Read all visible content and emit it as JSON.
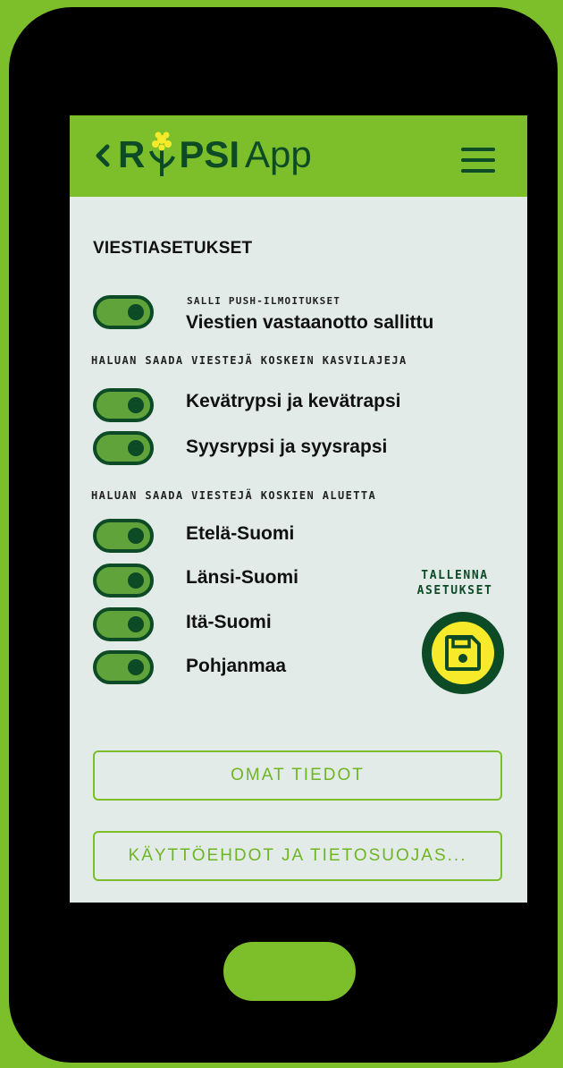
{
  "app": {
    "logo_r": "R",
    "logo_psi": "PSI",
    "logo_app": "App"
  },
  "settings": {
    "title": "VIESTIASETUKSET",
    "push": {
      "sublabel": "SALLI PUSH-ILMOITUKSET",
      "label": "Viestien vastaanotto sallittu",
      "on": true
    },
    "crops_heading": "HALUAN SAADA VIESTEJÄ KOSKEIN KASVILAJEJA",
    "crops": [
      {
        "label": "Kevätrypsi ja kevätrapsi",
        "on": true
      },
      {
        "label": "Syysrypsi ja syysrapsi",
        "on": true
      }
    ],
    "regions_heading": "HALUAN SAADA VIESTEJÄ KOSKIEN ALUETTA",
    "regions": [
      {
        "label": "Etelä-Suomi",
        "on": true
      },
      {
        "label": "Länsi-Suomi",
        "on": true
      },
      {
        "label": "Itä-Suomi",
        "on": true
      },
      {
        "label": "Pohjanmaa",
        "on": true
      }
    ]
  },
  "save": {
    "line1": "TALLENNA",
    "line2": "ASETUKSET"
  },
  "buttons": {
    "profile": "OMAT TIEDOT",
    "terms": "KÄYTTÖEHDOT JA TIETOSUOJAS..."
  },
  "colors": {
    "brand_green": "#7dbf2b",
    "dark_green": "#0d4a26",
    "save_yellow": "#f7ea2a",
    "screen_bg": "#e3ebe9"
  }
}
